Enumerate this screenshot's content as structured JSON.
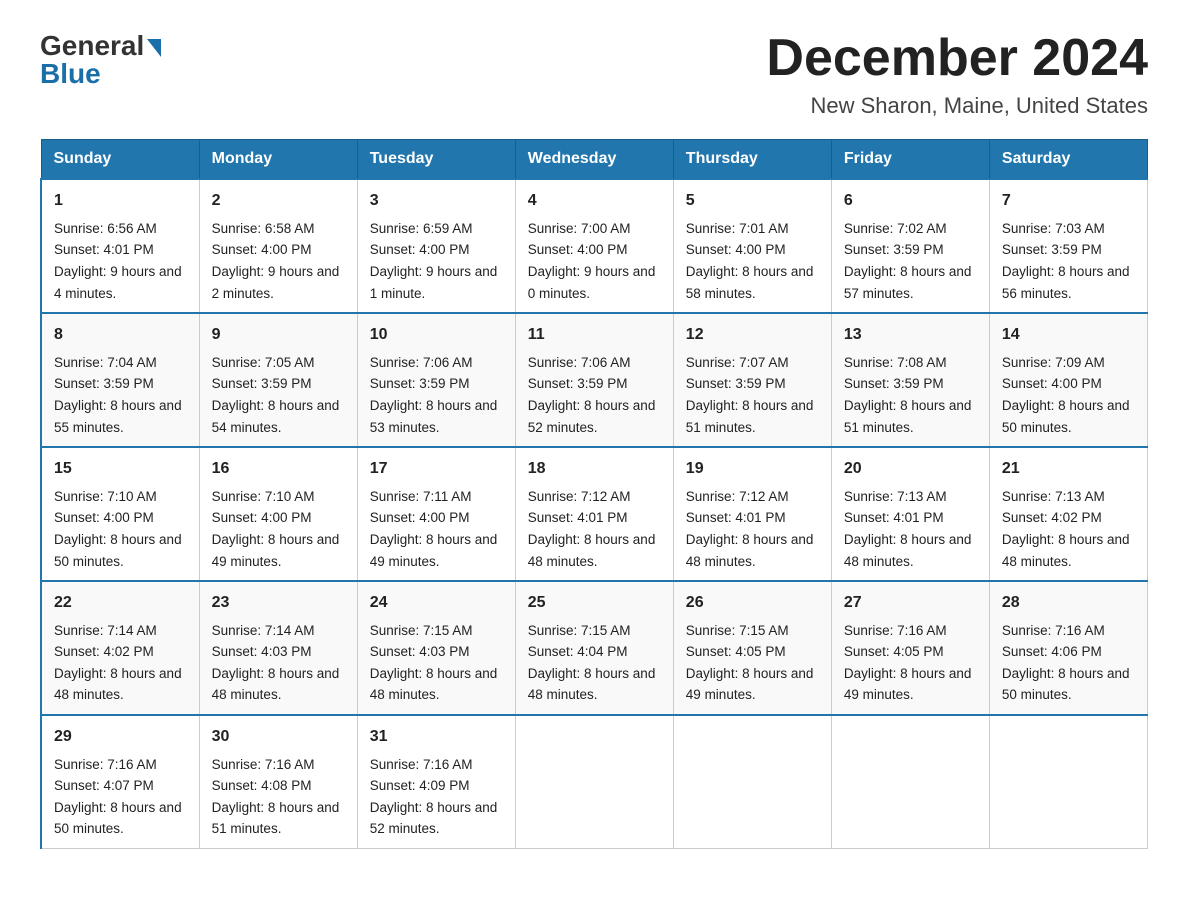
{
  "header": {
    "logo_general": "General",
    "logo_blue": "Blue",
    "month_title": "December 2024",
    "location": "New Sharon, Maine, United States"
  },
  "days_of_week": [
    "Sunday",
    "Monday",
    "Tuesday",
    "Wednesday",
    "Thursday",
    "Friday",
    "Saturday"
  ],
  "weeks": [
    [
      {
        "day": "1",
        "sunrise": "6:56 AM",
        "sunset": "4:01 PM",
        "daylight": "9 hours and 4 minutes."
      },
      {
        "day": "2",
        "sunrise": "6:58 AM",
        "sunset": "4:00 PM",
        "daylight": "9 hours and 2 minutes."
      },
      {
        "day": "3",
        "sunrise": "6:59 AM",
        "sunset": "4:00 PM",
        "daylight": "9 hours and 1 minute."
      },
      {
        "day": "4",
        "sunrise": "7:00 AM",
        "sunset": "4:00 PM",
        "daylight": "9 hours and 0 minutes."
      },
      {
        "day": "5",
        "sunrise": "7:01 AM",
        "sunset": "4:00 PM",
        "daylight": "8 hours and 58 minutes."
      },
      {
        "day": "6",
        "sunrise": "7:02 AM",
        "sunset": "3:59 PM",
        "daylight": "8 hours and 57 minutes."
      },
      {
        "day": "7",
        "sunrise": "7:03 AM",
        "sunset": "3:59 PM",
        "daylight": "8 hours and 56 minutes."
      }
    ],
    [
      {
        "day": "8",
        "sunrise": "7:04 AM",
        "sunset": "3:59 PM",
        "daylight": "8 hours and 55 minutes."
      },
      {
        "day": "9",
        "sunrise": "7:05 AM",
        "sunset": "3:59 PM",
        "daylight": "8 hours and 54 minutes."
      },
      {
        "day": "10",
        "sunrise": "7:06 AM",
        "sunset": "3:59 PM",
        "daylight": "8 hours and 53 minutes."
      },
      {
        "day": "11",
        "sunrise": "7:06 AM",
        "sunset": "3:59 PM",
        "daylight": "8 hours and 52 minutes."
      },
      {
        "day": "12",
        "sunrise": "7:07 AM",
        "sunset": "3:59 PM",
        "daylight": "8 hours and 51 minutes."
      },
      {
        "day": "13",
        "sunrise": "7:08 AM",
        "sunset": "3:59 PM",
        "daylight": "8 hours and 51 minutes."
      },
      {
        "day": "14",
        "sunrise": "7:09 AM",
        "sunset": "4:00 PM",
        "daylight": "8 hours and 50 minutes."
      }
    ],
    [
      {
        "day": "15",
        "sunrise": "7:10 AM",
        "sunset": "4:00 PM",
        "daylight": "8 hours and 50 minutes."
      },
      {
        "day": "16",
        "sunrise": "7:10 AM",
        "sunset": "4:00 PM",
        "daylight": "8 hours and 49 minutes."
      },
      {
        "day": "17",
        "sunrise": "7:11 AM",
        "sunset": "4:00 PM",
        "daylight": "8 hours and 49 minutes."
      },
      {
        "day": "18",
        "sunrise": "7:12 AM",
        "sunset": "4:01 PM",
        "daylight": "8 hours and 48 minutes."
      },
      {
        "day": "19",
        "sunrise": "7:12 AM",
        "sunset": "4:01 PM",
        "daylight": "8 hours and 48 minutes."
      },
      {
        "day": "20",
        "sunrise": "7:13 AM",
        "sunset": "4:01 PM",
        "daylight": "8 hours and 48 minutes."
      },
      {
        "day": "21",
        "sunrise": "7:13 AM",
        "sunset": "4:02 PM",
        "daylight": "8 hours and 48 minutes."
      }
    ],
    [
      {
        "day": "22",
        "sunrise": "7:14 AM",
        "sunset": "4:02 PM",
        "daylight": "8 hours and 48 minutes."
      },
      {
        "day": "23",
        "sunrise": "7:14 AM",
        "sunset": "4:03 PM",
        "daylight": "8 hours and 48 minutes."
      },
      {
        "day": "24",
        "sunrise": "7:15 AM",
        "sunset": "4:03 PM",
        "daylight": "8 hours and 48 minutes."
      },
      {
        "day": "25",
        "sunrise": "7:15 AM",
        "sunset": "4:04 PM",
        "daylight": "8 hours and 48 minutes."
      },
      {
        "day": "26",
        "sunrise": "7:15 AM",
        "sunset": "4:05 PM",
        "daylight": "8 hours and 49 minutes."
      },
      {
        "day": "27",
        "sunrise": "7:16 AM",
        "sunset": "4:05 PM",
        "daylight": "8 hours and 49 minutes."
      },
      {
        "day": "28",
        "sunrise": "7:16 AM",
        "sunset": "4:06 PM",
        "daylight": "8 hours and 50 minutes."
      }
    ],
    [
      {
        "day": "29",
        "sunrise": "7:16 AM",
        "sunset": "4:07 PM",
        "daylight": "8 hours and 50 minutes."
      },
      {
        "day": "30",
        "sunrise": "7:16 AM",
        "sunset": "4:08 PM",
        "daylight": "8 hours and 51 minutes."
      },
      {
        "day": "31",
        "sunrise": "7:16 AM",
        "sunset": "4:09 PM",
        "daylight": "8 hours and 52 minutes."
      },
      null,
      null,
      null,
      null
    ]
  ],
  "labels": {
    "sunrise": "Sunrise:",
    "sunset": "Sunset:",
    "daylight": "Daylight:"
  }
}
